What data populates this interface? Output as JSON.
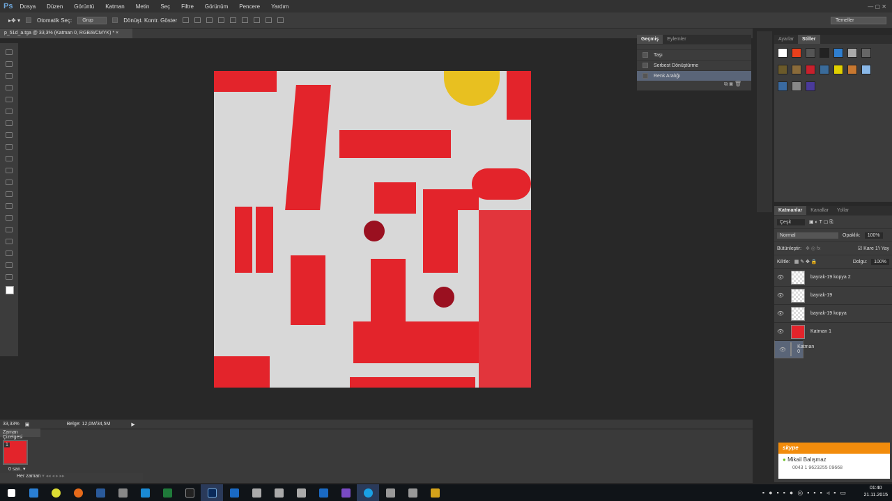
{
  "app": {
    "logo": "Ps",
    "workspace": "Temeller"
  },
  "menu": [
    "Dosya",
    "Düzen",
    "Görüntü",
    "Katman",
    "Metin",
    "Seç",
    "Filtre",
    "Görünüm",
    "Pencere",
    "Yardım"
  ],
  "options": {
    "auto_select": "Otomatik Seç:",
    "auto_select_value": "Grup",
    "transform": "Dönüşt. Kontr. Göster"
  },
  "document": {
    "tab": "p_51d_a.tga @ 33,3% (Katman 0, RGB/8/CMYK) *",
    "close": "×"
  },
  "history": {
    "tabs": [
      "Geçmiş",
      "Eylemler"
    ],
    "items": [
      "Taşı",
      "Serbest Dönüştürme",
      "Renk Aralığı"
    ]
  },
  "styles": {
    "tabs": [
      "Ayarlar",
      "Stiller"
    ],
    "swatches": [
      "#ffffff",
      "#e8401c",
      "#555555",
      "#222222",
      "#2f7fd0",
      "#aaaaaa",
      "#666666",
      "#6b5a2a",
      "#8a6b3a",
      "#c8202c",
      "#3a6b9a",
      "#e0d000",
      "#c87830",
      "#8ab8e8",
      "#3a6aa0",
      "#888888",
      "#4a3a9a"
    ]
  },
  "layers": {
    "tabs": [
      "Katmanlar",
      "Kanallar",
      "Yollar"
    ],
    "filter": "Çeşit",
    "blend": "Normal",
    "opacity_label": "Opaklık:",
    "opacity": "100%",
    "unify": "Bütünleştir:",
    "propagate": "Kare 1'i Yay",
    "lock": "Kilitle:",
    "fill_label": "Dolgu:",
    "fill": "100%",
    "items": [
      {
        "name": "bayrak-19 kopya 2"
      },
      {
        "name": "bayrak-19"
      },
      {
        "name": "bayrak-19 kopya"
      },
      {
        "name": "Katman 1"
      },
      {
        "name": "Katman 0"
      }
    ]
  },
  "status": {
    "zoom": "33,33%",
    "doc": "Belge: 12,0M/34,5M"
  },
  "timeline": {
    "title": "Zaman Çizelgesi",
    "frame_num": "1",
    "frame_time": "0 san.",
    "loop": "Her zaman"
  },
  "notification": {
    "app": "skype",
    "name": "Mikail Balışmaz",
    "phone": "0043 1 9623255 09668"
  },
  "clock": {
    "time": "01:40",
    "date": "21.11.2015"
  }
}
